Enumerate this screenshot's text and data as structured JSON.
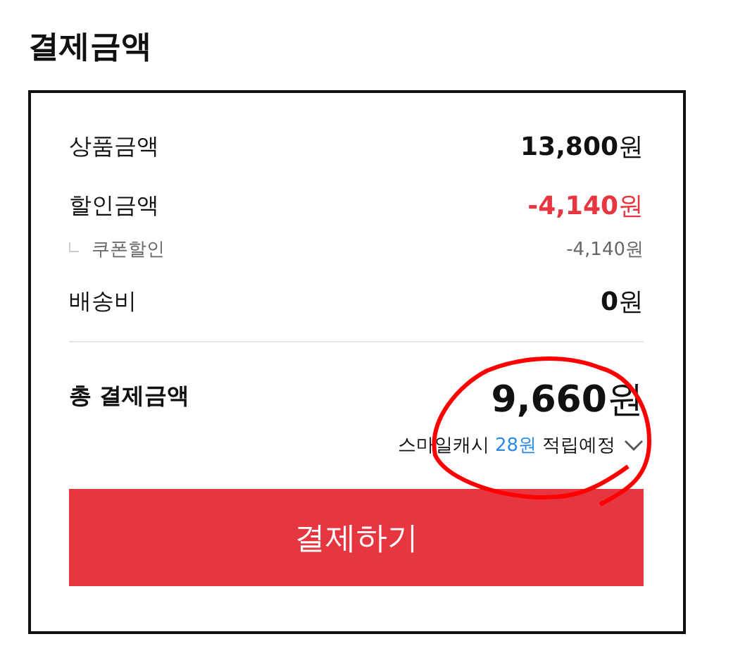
{
  "title": "결제금액",
  "rows": [
    {
      "kind": "item",
      "label": "상품금액",
      "amount": "**13,800**원"
    },
    {
      "kind": "discount",
      "label": "할인금액",
      "amount": "**-4,140**원"
    },
    {
      "kind": "sub",
      "label": "쿠폰할인",
      "amount": "-4,140원"
    },
    {
      "kind": "item",
      "label": "배송비",
      "amount": "**0**원"
    }
  ],
  "total": {
    "label": "총 결제금액",
    "amount": "**9,660**원",
    "cashback": {
      "prefix": "스마일캐시",
      "amount": "28원",
      "suffix": "적립예정",
      "expanded": false
    }
  },
  "pay_button": "결제하기"
}
